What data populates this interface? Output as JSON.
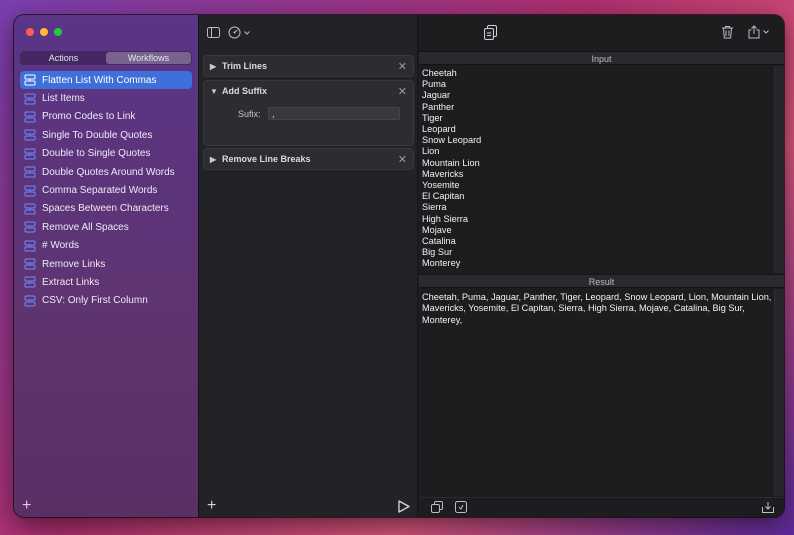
{
  "sidebar": {
    "segments": [
      {
        "label": "Actions",
        "active": false
      },
      {
        "label": "Workflows",
        "active": true
      }
    ],
    "items": [
      {
        "label": "Flatten List With Commas",
        "selected": true
      },
      {
        "label": "List Items"
      },
      {
        "label": "Promo Codes to Link"
      },
      {
        "label": "Single To Double Quotes"
      },
      {
        "label": "Double to Single Quotes"
      },
      {
        "label": "Double Quotes Around Words"
      },
      {
        "label": "Comma Separated Words"
      },
      {
        "label": "Spaces Between Characters"
      },
      {
        "label": "Remove All Spaces"
      },
      {
        "label": "# Words"
      },
      {
        "label": "Remove Links"
      },
      {
        "label": "Extract Links"
      },
      {
        "label": "CSV: Only First Column"
      }
    ],
    "add_label": "+"
  },
  "steps": [
    {
      "title": "Trim Lines",
      "expanded": false
    },
    {
      "title": "Add Suffix",
      "expanded": true,
      "param_label": "Sufix:",
      "param_value": ","
    },
    {
      "title": "Remove Line Breaks",
      "expanded": false
    }
  ],
  "middle": {
    "add_label": "+"
  },
  "input": {
    "header": "Input",
    "lines": [
      "Cheetah",
      "Puma",
      "Jaguar",
      "Panther",
      "Tiger",
      "Leopard",
      "Snow Leopard",
      "Lion",
      "Mountain Lion",
      "Mavericks",
      "Yosemite",
      "El Capitan",
      "Sierra",
      "High Sierra",
      "Mojave",
      "Catalina",
      "Big Sur",
      "Monterey"
    ]
  },
  "result": {
    "header": "Result",
    "text": "Cheetah, Puma, Jaguar, Panther, Tiger, Leopard, Snow Leopard, Lion, Mountain Lion, Mavericks, Yosemite, El Capitan, Sierra, High Sierra, Mojave, Catalina, Big Sur, Monterey,"
  },
  "icons": {
    "sidebar_toggle": "sidebar-toggle-icon",
    "gauge": "gauge-icon",
    "copy": "copy-icon",
    "trash": "trash-icon",
    "share": "share-icon",
    "play": "play-icon",
    "workflow": "workflow-icon"
  },
  "colors": {
    "selected": "#3f6fd8",
    "workflow_icon": "#6f8cff"
  }
}
